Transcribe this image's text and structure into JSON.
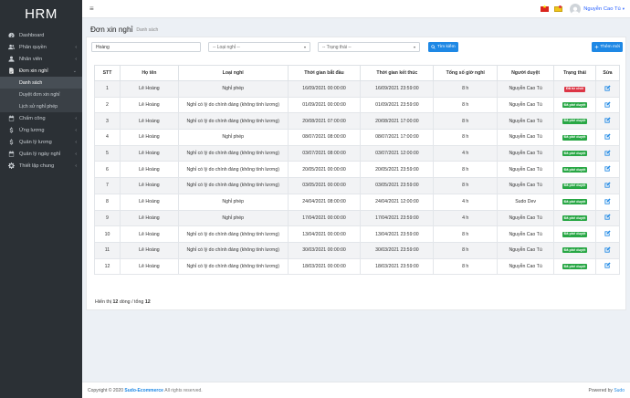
{
  "app": {
    "logo": "HRM"
  },
  "sidebar": {
    "items": [
      {
        "label": "Dashboard",
        "icon": "dashboard-icon",
        "chevron": ""
      },
      {
        "label": "Phân quyền",
        "icon": "users-icon",
        "chevron": "‹"
      },
      {
        "label": "Nhân viên",
        "icon": "user-icon",
        "chevron": "‹"
      },
      {
        "label": "Đơn xin nghỉ",
        "icon": "document-icon",
        "chevron": "⌄"
      }
    ],
    "sub_items": [
      {
        "label": "Danh sách"
      },
      {
        "label": "Duyệt đơn xin nghỉ"
      },
      {
        "label": "Lịch sử nghỉ phép"
      }
    ],
    "items_after": [
      {
        "label": "Chấm công",
        "icon": "calendar-icon",
        "chevron": "‹"
      },
      {
        "label": "Ứng lương",
        "icon": "dollar-icon",
        "chevron": "‹"
      },
      {
        "label": "Quản lý lương",
        "icon": "dollar-icon",
        "chevron": "‹"
      },
      {
        "label": "Quản lý ngày nghỉ",
        "icon": "calendar-icon",
        "chevron": "‹"
      },
      {
        "label": "Thiết lập chung",
        "icon": "gear-icon",
        "chevron": "‹"
      }
    ]
  },
  "topbar": {
    "user_name": "Nguyễn Cao Tú",
    "caret": "▾",
    "hamburger": "≡"
  },
  "page": {
    "title": "Đơn xin nghỉ",
    "subtitle": "Danh sách"
  },
  "filters": {
    "search_value": "Hoàng",
    "leave_type_value": "-- Loại nghỉ --",
    "status_value": "-- Trạng thái --",
    "select_arrow": "▾",
    "search_button": "Tìm kiếm",
    "add_button": "Thêm mới"
  },
  "table": {
    "headers": [
      "STT",
      "Họ tên",
      "Loại nghỉ",
      "Thời gian bắt đầu",
      "Thời gian kết thúc",
      "Tổng số giờ nghỉ",
      "Người duyệt",
      "Trạng thái",
      "Sửa"
    ],
    "rows": [
      {
        "stt": "1",
        "name": "Lê Hoàng",
        "type": "Nghỉ phép",
        "start": "16/09/2021 00:00:00",
        "end": "16/09/2021 23:59:00",
        "hours": "8 h",
        "approver": "Nguyễn Cao Tú",
        "status": "Đã từ chối",
        "status_color": "#dc3545"
      },
      {
        "stt": "2",
        "name": "Lê Hoàng",
        "type": "Nghỉ có lý do chính đáng (không tính lương)",
        "start": "01/09/2021 00:00:00",
        "end": "01/09/2021 23:59:00",
        "hours": "8 h",
        "approver": "Nguyễn Cao Tú",
        "status": "Đã phê duyệt",
        "status_color": "#28a745"
      },
      {
        "stt": "3",
        "name": "Lê Hoàng",
        "type": "Nghỉ có lý do chính đáng (không tính lương)",
        "start": "20/08/2021 07:00:00",
        "end": "20/08/2021 17:00:00",
        "hours": "8 h",
        "approver": "Nguyễn Cao Tú",
        "status": "Đã phê duyệt",
        "status_color": "#28a745"
      },
      {
        "stt": "4",
        "name": "Lê Hoàng",
        "type": "Nghỉ phép",
        "start": "08/07/2021 08:00:00",
        "end": "08/07/2021 17:00:00",
        "hours": "8 h",
        "approver": "Nguyễn Cao Tú",
        "status": "Đã phê duyệt",
        "status_color": "#28a745"
      },
      {
        "stt": "5",
        "name": "Lê Hoàng",
        "type": "Nghỉ có lý do chính đáng (không tính lương)",
        "start": "03/07/2021 08:00:00",
        "end": "03/07/2021 12:00:00",
        "hours": "4 h",
        "approver": "Nguyễn Cao Tú",
        "status": "Đã phê duyệt",
        "status_color": "#28a745"
      },
      {
        "stt": "6",
        "name": "Lê Hoàng",
        "type": "Nghỉ có lý do chính đáng (không tính lương)",
        "start": "20/05/2021 00:00:00",
        "end": "20/05/2021 23:59:00",
        "hours": "8 h",
        "approver": "Nguyễn Cao Tú",
        "status": "Đã phê duyệt",
        "status_color": "#28a745"
      },
      {
        "stt": "7",
        "name": "Lê Hoàng",
        "type": "Nghỉ có lý do chính đáng (không tính lương)",
        "start": "03/05/2021 00:00:00",
        "end": "03/05/2021 23:59:00",
        "hours": "8 h",
        "approver": "Nguyễn Cao Tú",
        "status": "Đã phê duyệt",
        "status_color": "#28a745"
      },
      {
        "stt": "8",
        "name": "Lê Hoàng",
        "type": "Nghỉ phép",
        "start": "24/04/2021 08:00:00",
        "end": "24/04/2021 12:00:00",
        "hours": "4 h",
        "approver": "Sudo Dev",
        "status": "Đã phê duyệt",
        "status_color": "#28a745"
      },
      {
        "stt": "9",
        "name": "Lê Hoàng",
        "type": "Nghỉ phép",
        "start": "17/04/2021 00:00:00",
        "end": "17/04/2021 23:59:00",
        "hours": "4 h",
        "approver": "Nguyễn Cao Tú",
        "status": "Đã phê duyệt",
        "status_color": "#28a745"
      },
      {
        "stt": "10",
        "name": "Lê Hoàng",
        "type": "Nghỉ có lý do chính đáng (không tính lương)",
        "start": "13/04/2021 00:00:00",
        "end": "13/04/2021 23:59:00",
        "hours": "8 h",
        "approver": "Nguyễn Cao Tú",
        "status": "Đã phê duyệt",
        "status_color": "#28a745"
      },
      {
        "stt": "11",
        "name": "Lê Hoàng",
        "type": "Nghỉ có lý do chính đáng (không tính lương)",
        "start": "30/03/2021 00:00:00",
        "end": "30/03/2021 23:59:00",
        "hours": "8 h",
        "approver": "Nguyễn Cao Tú",
        "status": "Đã phê duyệt",
        "status_color": "#28a745"
      },
      {
        "stt": "12",
        "name": "Lê Hoàng",
        "type": "Nghỉ có lý do chính đáng (không tính lương)",
        "start": "18/03/2021 00:00:00",
        "end": "18/03/2021 23:59:00",
        "hours": "8 h",
        "approver": "Nguyễn Cao Tú",
        "status": "Đã phê duyệt",
        "status_color": "#28a745"
      }
    ]
  },
  "summary": {
    "prefix": "Hiển thị",
    "shown": "12",
    "middle": "dòng / tổng",
    "total": "12"
  },
  "footer": {
    "copyright": "Copyright © 2020",
    "brand": "Sudo-Ecommerce",
    "rights": "All rights reserved.",
    "powered_prefix": "Powered by",
    "powered_by": "Sudo"
  },
  "colors": {
    "sidebar_bg": "#2b3035",
    "accent": "#1e88e5",
    "approved": "#28a745",
    "rejected": "#dc3545"
  }
}
